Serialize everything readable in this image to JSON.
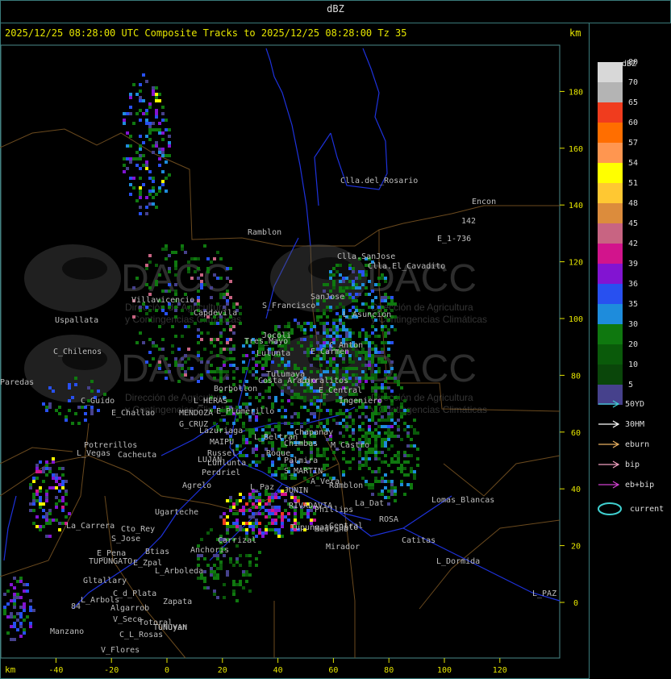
{
  "title": "dBZ",
  "header": "2025/12/25 08:28:00 UTC Composite Tracks to 2025/12/25 08:28:00 Tz 35",
  "km_label": "km",
  "map": {
    "x_ticks": [
      "-40",
      "-20",
      "0",
      "20",
      "40",
      "60",
      "80",
      "100",
      "120"
    ],
    "y_ticks": [
      "180",
      "160",
      "140",
      "120",
      "100",
      "80",
      "60",
      "40",
      "20",
      "0"
    ],
    "places": [
      "Clla.del_Rosario",
      "Encon",
      "Ramblon",
      "E_1-736",
      "142",
      "Clla.SanJose",
      "Clla.El_Cavadito",
      "Villavicencio",
      "Uspallata",
      "Capdevila",
      "S_Francisco",
      "SanJose",
      "L_Asuncion",
      "C_Chilenos",
      "Jocoli",
      "Tres_Mayo",
      "Lulunta",
      "E_Carmen",
      "C_Anton",
      "Paredas",
      "L_HERAS",
      "Borbollon",
      "Costa_Araujo",
      "E_Central",
      "Tulumaya",
      "Corralitos",
      "Ingeniero",
      "C_Guido",
      "E_Challao",
      "MENDOZA",
      "G_CRUZ",
      "Lazuriaga",
      "E_Plumerillo",
      "Potrerillos",
      "Cacheuta",
      "L_Vegas",
      "MAIPU",
      "Russel",
      "L_Beltran",
      "Chimbas",
      "M_Castro",
      "Chapanay",
      "LUJAN",
      "Lunlunta",
      "Perdriel",
      "Palmira",
      "Roque",
      "S_MARTIN",
      "A_Vera",
      "Ramblon",
      "Agrelo",
      "Ugarteche",
      "L_Paz",
      "JUNIN",
      "Lomas_Blancas",
      "RIVADAVIA",
      "Phillips",
      "La_Dat",
      "La_Carrera",
      "Cto_Rey",
      "S_Jose",
      "Carrizal",
      "Tupungato_Dpto",
      "Medrano",
      "ROSA",
      "Central",
      "Catitas",
      "E_Pena",
      "TUPUNGATO",
      "Btias",
      "Anchoris",
      "Mirador",
      "L_Dormida",
      "E_Zpal",
      "L_Arboleda",
      "Gltallary",
      "C_d_Plata",
      "Zapata",
      "L_PAZ",
      "L_Arbols",
      "Algarrob",
      "V_Seco",
      "Manzano",
      "Tunuyan",
      "TUNUYAN",
      "C_L_Rosas",
      "Totoral",
      "V_Flores",
      "84"
    ],
    "watermarks": [
      {
        "logo": "DACC",
        "line1": "Dirección de Agricultura",
        "line2": "y Contingencias Climáticas"
      },
      {
        "logo": "DACC",
        "line1": "Dirección de Agricultura",
        "line2": "y Contingencias Climáticas"
      },
      {
        "logo": "DACC",
        "line1": "Dirección de Agricultura",
        "line2": "y Contingencias Climáticas"
      },
      {
        "logo": "DACC",
        "line1": "Dirección de Agricultura",
        "line2": "y Contingencias Climáticas"
      }
    ]
  },
  "legend": {
    "title": "dBZ",
    "scale": [
      {
        "value": "80",
        "color": "#d8d8d8"
      },
      {
        "value": "70",
        "color": "#b4b4b4"
      },
      {
        "value": "65",
        "color": "#f03c1e"
      },
      {
        "value": "60",
        "color": "#ff6e00"
      },
      {
        "value": "57",
        "color": "#ff9650"
      },
      {
        "value": "54",
        "color": "#ffff00"
      },
      {
        "value": "51",
        "color": "#ffc832"
      },
      {
        "value": "48",
        "color": "#dc8c3c"
      },
      {
        "value": "45",
        "color": "#c86482"
      },
      {
        "value": "42",
        "color": "#d2148c"
      },
      {
        "value": "39",
        "color": "#8214d2"
      },
      {
        "value": "36",
        "color": "#2850f0"
      },
      {
        "value": "35",
        "color": "#1e8cdc"
      },
      {
        "value": "30",
        "color": "#0f780f"
      },
      {
        "value": "20",
        "color": "#0a5a0a"
      },
      {
        "value": "10",
        "color": "#0a460a"
      },
      {
        "value": "5",
        "color": "#46418c"
      }
    ],
    "tracks": [
      {
        "label": "50YD",
        "color": "#40d0d0"
      },
      {
        "label": "30HM",
        "color": "#ffffff"
      },
      {
        "label": "eburn",
        "color": "#e8b060"
      },
      {
        "label": "bip",
        "color": "#f0a0c0"
      },
      {
        "label": "eb+bip",
        "color": "#d040d0"
      }
    ],
    "current": {
      "label": "current",
      "color": "#40d0d0"
    }
  }
}
